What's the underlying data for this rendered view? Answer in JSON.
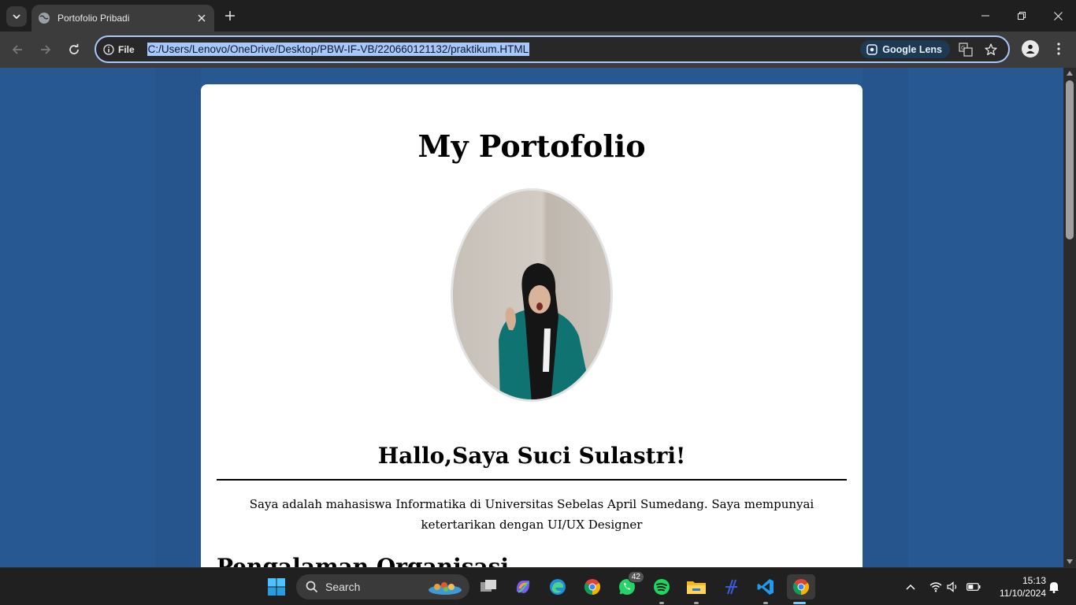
{
  "browser": {
    "tab": {
      "title": "Portofolio Pribadi"
    },
    "site_info_label": "File",
    "url": "C:/Users/Lenovo/OneDrive/Desktop/PBW-IF-VB/220660121132/praktikum.HTML",
    "lens_label": "Google Lens"
  },
  "page": {
    "title": "My Portofolio",
    "greeting": "Hallo,Saya Suci Sulastri!",
    "bio": "Saya adalah mahasiswa Informatika di Universitas Sebelas April Sumedang. Saya mempunyai ketertarikan dengan UI/UX Designer",
    "section_title": "Pengalaman Organisasi"
  },
  "taskbar": {
    "search_label": "Search",
    "whatsapp_badge": "42",
    "clock_time": "15:13",
    "clock_date": "11/10/2024"
  },
  "colors": {
    "page_background": "#285892",
    "card": "#ffffff",
    "omnibox_focus": "#a8c7fa"
  }
}
